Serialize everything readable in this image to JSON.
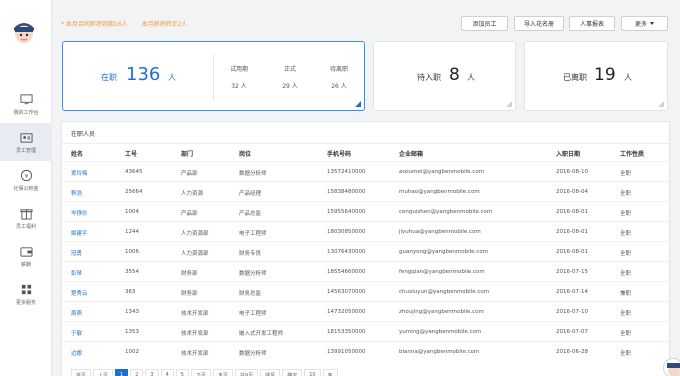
{
  "colors": {
    "accent": "#1e6fd0",
    "notice": "#f39a3a"
  },
  "sidebar": {
    "items": [
      {
        "label": "我的工作台",
        "icon": "monitor-icon"
      },
      {
        "label": "员工管理",
        "icon": "id-card-icon"
      },
      {
        "label": "社保公积金",
        "icon": "coin-icon"
      },
      {
        "label": "员工福利",
        "icon": "gift-icon"
      },
      {
        "label": "薪酬",
        "icon": "wallet-icon"
      },
      {
        "label": "更多服务",
        "icon": "grid-icon"
      }
    ]
  },
  "notice": {
    "contract": "* 本月合同即将到期16人",
    "probation": "本月即将转正2人"
  },
  "toolbar": {
    "add": "添加员工",
    "import": "导入花名册",
    "report": "人事报表",
    "more": "更多"
  },
  "stats": {
    "active": {
      "label": "在职",
      "count": "136",
      "unit": "人",
      "probation": {
        "label": "试用期",
        "value": "32 人"
      },
      "regular": {
        "label": "正式",
        "value": "29 人"
      },
      "leaving": {
        "label": "待离职",
        "value": "26 人"
      }
    },
    "pending": {
      "label": "待入职",
      "count": "8",
      "unit": "人"
    },
    "left": {
      "label": "已离职",
      "count": "19",
      "unit": "人"
    }
  },
  "table": {
    "title": "在职人员",
    "headers": [
      "姓名",
      "工号",
      "部门",
      "岗位",
      "手机号码",
      "企业邮箱",
      "入职日期",
      "工作性质"
    ],
    "rows": [
      [
        "爱玲梅",
        "43645",
        "产品部",
        "数据分析师",
        "13572410000",
        "aixiumei@yangbenmobile.com",
        "2016-08-10",
        "全职"
      ],
      [
        "穆浩",
        "25664",
        "人力资源",
        "产品经理",
        "15838480000",
        "muhao@yangbenmobile.com",
        "2016-08-04",
        "全职"
      ],
      [
        "岑铮珍",
        "1004",
        "产品部",
        "产品总监",
        "15955640000",
        "cenguizhen@yangbenmobile.com",
        "2016-08-01",
        "全职"
      ],
      [
        "姬建平",
        "1244",
        "人力资源部",
        "电子工程师",
        "18030850000",
        "jiyuhua@yangbenmobile.com",
        "2016-08-01",
        "全职"
      ],
      [
        "冠勇",
        "1006",
        "人力资源部",
        "财务专员",
        "13076430000",
        "guanyong@yangbenmobile.com",
        "2016-08-01",
        "全职"
      ],
      [
        "彭琴",
        "3554",
        "财务部",
        "数据分析师",
        "18554660000",
        "fengqian@yangbenmobile.com",
        "2016-07-15",
        "全职"
      ],
      [
        "楚秀云",
        "363",
        "财务部",
        "财务总监",
        "14563070000",
        "chuxiuyun@yangbenmobile.com",
        "2016-07-14",
        "兼职"
      ],
      [
        "周燕",
        "1343",
        "技术开发部",
        "电子工程师",
        "14732050000",
        "zhoujing@yangbenmobile.com",
        "2016-07-10",
        "全职"
      ],
      [
        "于敏",
        "1353",
        "技术开发部",
        "嵌入式开发工程师",
        "18153350000",
        "yuming@yangbenmobile.com",
        "2016-07-07",
        "全职"
      ],
      [
        "边娜",
        "1002",
        "技术开发部",
        "数据分析师",
        "13991050000",
        "bianna@yangbenmobile.com",
        "2016-06-28",
        "全职"
      ]
    ]
  },
  "pager": [
    "首页",
    "上页",
    "1",
    "2",
    "3",
    "4",
    "5",
    "下页",
    "末页",
    "共9页",
    "跳至",
    "确定",
    "10",
    "条"
  ]
}
